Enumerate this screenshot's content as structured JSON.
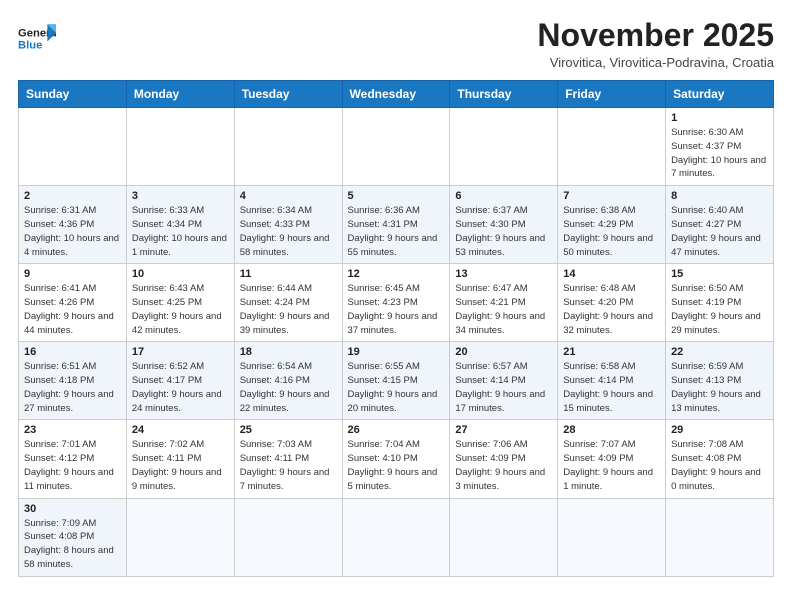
{
  "logo": {
    "line1": "General",
    "line2": "Blue"
  },
  "title": "November 2025",
  "subtitle": "Virovitica, Virovitica-Podravina, Croatia",
  "weekdays": [
    "Sunday",
    "Monday",
    "Tuesday",
    "Wednesday",
    "Thursday",
    "Friday",
    "Saturday"
  ],
  "weeks": [
    [
      {
        "day": "",
        "info": ""
      },
      {
        "day": "",
        "info": ""
      },
      {
        "day": "",
        "info": ""
      },
      {
        "day": "",
        "info": ""
      },
      {
        "day": "",
        "info": ""
      },
      {
        "day": "",
        "info": ""
      },
      {
        "day": "1",
        "info": "Sunrise: 6:30 AM\nSunset: 4:37 PM\nDaylight: 10 hours and 7 minutes."
      }
    ],
    [
      {
        "day": "2",
        "info": "Sunrise: 6:31 AM\nSunset: 4:36 PM\nDaylight: 10 hours and 4 minutes."
      },
      {
        "day": "3",
        "info": "Sunrise: 6:33 AM\nSunset: 4:34 PM\nDaylight: 10 hours and 1 minute."
      },
      {
        "day": "4",
        "info": "Sunrise: 6:34 AM\nSunset: 4:33 PM\nDaylight: 9 hours and 58 minutes."
      },
      {
        "day": "5",
        "info": "Sunrise: 6:36 AM\nSunset: 4:31 PM\nDaylight: 9 hours and 55 minutes."
      },
      {
        "day": "6",
        "info": "Sunrise: 6:37 AM\nSunset: 4:30 PM\nDaylight: 9 hours and 53 minutes."
      },
      {
        "day": "7",
        "info": "Sunrise: 6:38 AM\nSunset: 4:29 PM\nDaylight: 9 hours and 50 minutes."
      },
      {
        "day": "8",
        "info": "Sunrise: 6:40 AM\nSunset: 4:27 PM\nDaylight: 9 hours and 47 minutes."
      }
    ],
    [
      {
        "day": "9",
        "info": "Sunrise: 6:41 AM\nSunset: 4:26 PM\nDaylight: 9 hours and 44 minutes."
      },
      {
        "day": "10",
        "info": "Sunrise: 6:43 AM\nSunset: 4:25 PM\nDaylight: 9 hours and 42 minutes."
      },
      {
        "day": "11",
        "info": "Sunrise: 6:44 AM\nSunset: 4:24 PM\nDaylight: 9 hours and 39 minutes."
      },
      {
        "day": "12",
        "info": "Sunrise: 6:45 AM\nSunset: 4:23 PM\nDaylight: 9 hours and 37 minutes."
      },
      {
        "day": "13",
        "info": "Sunrise: 6:47 AM\nSunset: 4:21 PM\nDaylight: 9 hours and 34 minutes."
      },
      {
        "day": "14",
        "info": "Sunrise: 6:48 AM\nSunset: 4:20 PM\nDaylight: 9 hours and 32 minutes."
      },
      {
        "day": "15",
        "info": "Sunrise: 6:50 AM\nSunset: 4:19 PM\nDaylight: 9 hours and 29 minutes."
      }
    ],
    [
      {
        "day": "16",
        "info": "Sunrise: 6:51 AM\nSunset: 4:18 PM\nDaylight: 9 hours and 27 minutes."
      },
      {
        "day": "17",
        "info": "Sunrise: 6:52 AM\nSunset: 4:17 PM\nDaylight: 9 hours and 24 minutes."
      },
      {
        "day": "18",
        "info": "Sunrise: 6:54 AM\nSunset: 4:16 PM\nDaylight: 9 hours and 22 minutes."
      },
      {
        "day": "19",
        "info": "Sunrise: 6:55 AM\nSunset: 4:15 PM\nDaylight: 9 hours and 20 minutes."
      },
      {
        "day": "20",
        "info": "Sunrise: 6:57 AM\nSunset: 4:14 PM\nDaylight: 9 hours and 17 minutes."
      },
      {
        "day": "21",
        "info": "Sunrise: 6:58 AM\nSunset: 4:14 PM\nDaylight: 9 hours and 15 minutes."
      },
      {
        "day": "22",
        "info": "Sunrise: 6:59 AM\nSunset: 4:13 PM\nDaylight: 9 hours and 13 minutes."
      }
    ],
    [
      {
        "day": "23",
        "info": "Sunrise: 7:01 AM\nSunset: 4:12 PM\nDaylight: 9 hours and 11 minutes."
      },
      {
        "day": "24",
        "info": "Sunrise: 7:02 AM\nSunset: 4:11 PM\nDaylight: 9 hours and 9 minutes."
      },
      {
        "day": "25",
        "info": "Sunrise: 7:03 AM\nSunset: 4:11 PM\nDaylight: 9 hours and 7 minutes."
      },
      {
        "day": "26",
        "info": "Sunrise: 7:04 AM\nSunset: 4:10 PM\nDaylight: 9 hours and 5 minutes."
      },
      {
        "day": "27",
        "info": "Sunrise: 7:06 AM\nSunset: 4:09 PM\nDaylight: 9 hours and 3 minutes."
      },
      {
        "day": "28",
        "info": "Sunrise: 7:07 AM\nSunset: 4:09 PM\nDaylight: 9 hours and 1 minute."
      },
      {
        "day": "29",
        "info": "Sunrise: 7:08 AM\nSunset: 4:08 PM\nDaylight: 9 hours and 0 minutes."
      }
    ],
    [
      {
        "day": "30",
        "info": "Sunrise: 7:09 AM\nSunset: 4:08 PM\nDaylight: 8 hours and 58 minutes."
      },
      {
        "day": "",
        "info": ""
      },
      {
        "day": "",
        "info": ""
      },
      {
        "day": "",
        "info": ""
      },
      {
        "day": "",
        "info": ""
      },
      {
        "day": "",
        "info": ""
      },
      {
        "day": "",
        "info": ""
      }
    ]
  ]
}
